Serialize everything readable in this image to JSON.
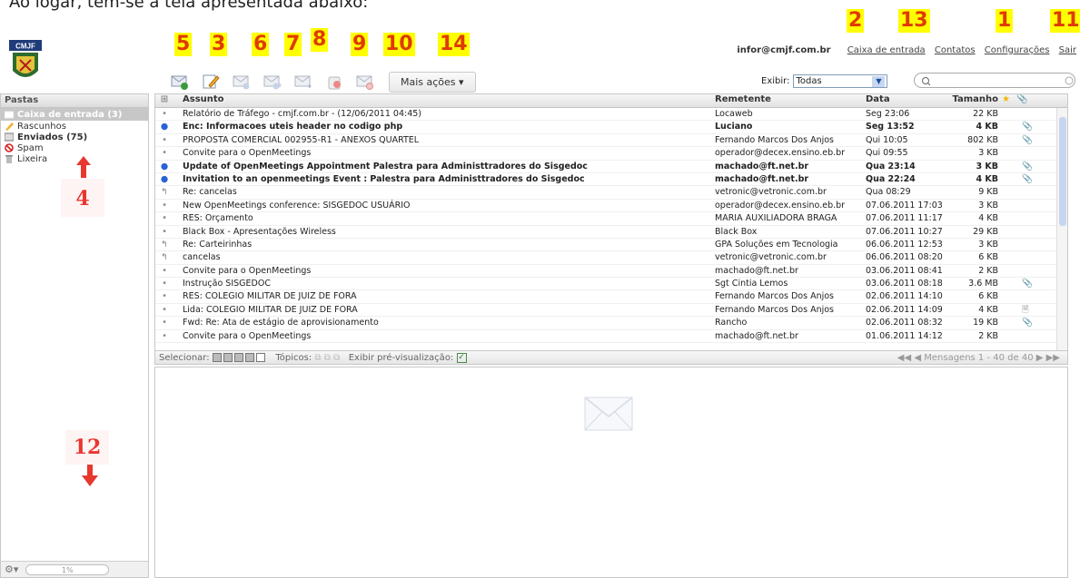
{
  "intro_text": "Ao logar, tem-se a tela apresentada abaixo:",
  "logo_text": "CMJF",
  "callouts": {
    "c5": "5",
    "c3": "3",
    "c6": "6",
    "c7": "7",
    "c8": "8",
    "c9": "9",
    "c10": "10",
    "c14": "14",
    "c2": "2",
    "c13": "13",
    "c1": "1",
    "c11": "11",
    "c4": "4",
    "c12": "12"
  },
  "topnav": {
    "email": "infor@cmjf.com.br",
    "inbox": "Caixa de entrada",
    "contacts": "Contatos",
    "settings": "Configurações",
    "logout": "Sair"
  },
  "toolbar": {
    "more_actions": "Mais ações"
  },
  "filter": {
    "label": "Exibir:",
    "value": "Todas"
  },
  "sidebar": {
    "header": "Pastas",
    "folders": [
      {
        "label": "Caixa de entrada (3)",
        "icon": "inbox-icon"
      },
      {
        "label": "Rascunhos",
        "icon": "pencil-icon"
      },
      {
        "label": "Enviados (75)",
        "icon": "sent-icon"
      },
      {
        "label": "Spam",
        "icon": "spam-icon"
      },
      {
        "label": "Lixeira",
        "icon": "trash-icon"
      }
    ],
    "quota": "1%"
  },
  "list": {
    "headers": {
      "subject": "Assunto",
      "from": "Remetente",
      "date": "Data",
      "size": "Tamanho"
    },
    "rows": [
      {
        "subject": "Relatório de Tráfego - cmjf.com.br - (12/06/2011 04:45)",
        "from": "Locaweb",
        "date": "Seg 23:06",
        "size": "22 KB",
        "unread": false,
        "att": ""
      },
      {
        "subject": "Enc: Informacoes uteis header no codigo php",
        "from": "Luciano",
        "date": "Seg 13:52",
        "size": "4 KB",
        "unread": true,
        "att": "📎"
      },
      {
        "subject": "PROPOSTA COMERCIAL 002955-R1 - ANEXOS QUARTEL",
        "from": "Fernando Marcos Dos Anjos",
        "date": "Qui 10:05",
        "size": "802 KB",
        "unread": false,
        "att": "📎"
      },
      {
        "subject": "Convite para o OpenMeetings",
        "from": "operador@decex.ensino.eb.br",
        "date": "Qui 09:55",
        "size": "3 KB",
        "unread": false,
        "att": ""
      },
      {
        "subject": "Update of OpenMeetings Appointment Palestra para Administtradores do Sisgedoc",
        "from": "machado@ft.net.br",
        "date": "Qua 23:14",
        "size": "3 KB",
        "unread": true,
        "att": "📎"
      },
      {
        "subject": "Invitation to an openmeetings Event : Palestra para Administtradores do Sisgedoc",
        "from": "machado@ft.net.br",
        "date": "Qua 22:24",
        "size": "4 KB",
        "unread": true,
        "att": "📎"
      },
      {
        "subject": "Re: cancelas",
        "from": "vetronic@vetronic.com.br",
        "date": "Qua 08:29",
        "size": "9 KB",
        "unread": false,
        "att": "",
        "replied": true
      },
      {
        "subject": "New OpenMeetings conference: SISGEDOC USUÁRIO",
        "from": "operador@decex.ensino.eb.br",
        "date": "07.06.2011 17:03",
        "size": "3 KB",
        "unread": false,
        "att": ""
      },
      {
        "subject": "RES: Orçamento",
        "from": "MARIA AUXILIADORA BRAGA",
        "date": "07.06.2011 11:17",
        "size": "4 KB",
        "unread": false,
        "att": ""
      },
      {
        "subject": "Black Box - Apresentações Wireless",
        "from": "Black Box",
        "date": "07.06.2011 10:27",
        "size": "29 KB",
        "unread": false,
        "att": ""
      },
      {
        "subject": "Re: Carteirinhas",
        "from": "GPA Soluções em Tecnologia",
        "date": "06.06.2011 12:53",
        "size": "3 KB",
        "unread": false,
        "att": "",
        "replied": true
      },
      {
        "subject": "cancelas",
        "from": "vetronic@vetronic.com.br",
        "date": "06.06.2011 08:20",
        "size": "6 KB",
        "unread": false,
        "att": "",
        "replied": true
      },
      {
        "subject": "Convite para o OpenMeetings",
        "from": "machado@ft.net.br",
        "date": "03.06.2011 08:41",
        "size": "2 KB",
        "unread": false,
        "att": ""
      },
      {
        "subject": "Instrução SISGEDOC",
        "from": "Sgt Cintia Lemos",
        "date": "03.06.2011 08:18",
        "size": "3.6 MB",
        "unread": false,
        "att": "📎"
      },
      {
        "subject": "RES: COLEGIO MILITAR DE JUIZ DE FORA",
        "from": "Fernando Marcos Dos Anjos",
        "date": "02.06.2011 14:10",
        "size": "6 KB",
        "unread": false,
        "att": ""
      },
      {
        "subject": "Lida: COLEGIO MILITAR DE JUIZ DE FORA",
        "from": "Fernando Marcos Dos Anjos",
        "date": "02.06.2011 14:09",
        "size": "4 KB",
        "unread": false,
        "att": "🗎"
      },
      {
        "subject": "Fwd: Re: Ata de estágio de aprovisionamento",
        "from": "Rancho",
        "date": "02.06.2011 08:32",
        "size": "19 KB",
        "unread": false,
        "att": "📎"
      },
      {
        "subject": "Convite para o OpenMeetings",
        "from": "machado@ft.net.br",
        "date": "01.06.2011 14:12",
        "size": "2 KB",
        "unread": false,
        "att": ""
      }
    ]
  },
  "listfoot": {
    "select_label": "Selecionar:",
    "topics_label": "Tópicos:",
    "preview_label": "Exibir pré-visualização:",
    "pager": "Mensagens 1 - 40 de 40"
  },
  "colors": {
    "accent": "#2a62d6",
    "callout_bg": "#ffff00",
    "callout_fg": "#e03a00"
  }
}
